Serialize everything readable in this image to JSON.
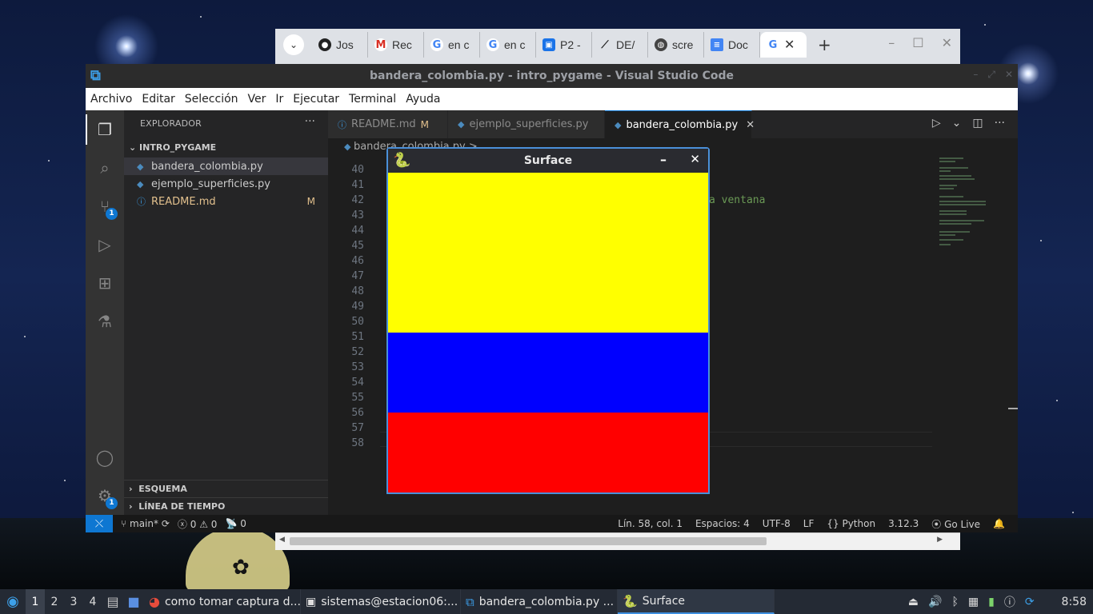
{
  "chrome": {
    "tabs": [
      {
        "label": "Jos",
        "icon": "github-icon",
        "color": "#222222"
      },
      {
        "label": "Rec",
        "icon": "gmail-icon",
        "color": "#d93025"
      },
      {
        "label": "en c",
        "icon": "google-icon",
        "color": "#4285f4"
      },
      {
        "label": "en c",
        "icon": "google-icon",
        "color": "#4285f4"
      },
      {
        "label": "P2 -",
        "icon": "classroom-icon",
        "color": "#1a73e8"
      },
      {
        "label": "DE/",
        "icon": "tool-icon",
        "color": "#222222"
      },
      {
        "label": "scre",
        "icon": "globe-icon",
        "color": "#444444"
      },
      {
        "label": "Doc",
        "icon": "docs-icon",
        "color": "#4285f4"
      }
    ],
    "active_tab_icon": "google-icon"
  },
  "vscode": {
    "title": "bandera_colombia.py - intro_pygame - Visual Studio Code",
    "menu": [
      "Archivo",
      "Editar",
      "Selección",
      "Ver",
      "Ir",
      "Ejecutar",
      "Terminal",
      "Ayuda"
    ],
    "sidebar": {
      "header": "EXPLORADOR",
      "project": "INTRO_PYGAME",
      "files": [
        {
          "name": "bandera_colombia.py",
          "badge": ""
        },
        {
          "name": "ejemplo_superficies.py",
          "badge": ""
        },
        {
          "name": "README.md",
          "badge": "M"
        }
      ],
      "outline": "ESQUEMA",
      "timeline": "LÍNEA DE TIEMPO"
    },
    "source_control_badge": "1",
    "settings_badge": "1",
    "tabs": [
      {
        "name": "README.md",
        "badge": "M"
      },
      {
        "name": "ejemplo_superficies.py",
        "badge": ""
      },
      {
        "name": "bandera_colombia.py",
        "badge": ""
      }
    ],
    "breadcrumb": "bandera_colombia.py >",
    "line_numbers": [
      "40",
      "41",
      "42",
      "43",
      "44",
      "45",
      "46",
      "47",
      "48",
      "49",
      "50",
      "51",
      "52",
      "53",
      "54",
      "55",
      "56",
      "57",
      "58"
    ],
    "visible_code_fragment": "a ventana",
    "status": {
      "branch": "main*",
      "errors": "0",
      "warnings": "0",
      "ports": "0",
      "position": "Lín. 58, col. 1",
      "spaces": "Espacios: 4",
      "encoding": "UTF-8",
      "eol": "LF",
      "language": "Python",
      "version": "3.12.3",
      "golive": "Go Live"
    }
  },
  "pygame_window": {
    "title": "Surface",
    "flag_colors": [
      "#ffff00",
      "#0000ff",
      "#ff0000"
    ]
  },
  "taskbar": {
    "workspaces": [
      "1",
      "2",
      "3",
      "4"
    ],
    "tasks": [
      {
        "label": "como tomar captura d...",
        "icon": "chrome-icon"
      },
      {
        "label": "sistemas@estacion06:...",
        "icon": "terminal-icon"
      },
      {
        "label": "bandera_colombia.py ...",
        "icon": "vscode-icon"
      },
      {
        "label": "Surface",
        "icon": "pygame-icon"
      }
    ],
    "clock": "8:58"
  }
}
